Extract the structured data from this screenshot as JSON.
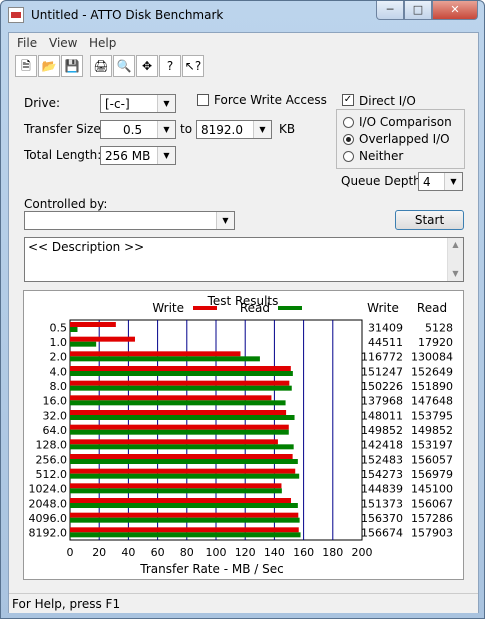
{
  "window": {
    "title": "Untitled - ATTO Disk Benchmark"
  },
  "menu": [
    "File",
    "View",
    "Help"
  ],
  "toolbar": [
    "new-file-icon",
    "open-folder-icon",
    "save-icon",
    "print-icon",
    "print-preview-icon",
    "move-icon",
    "help-icon",
    "context-help-icon"
  ],
  "form": {
    "drive_label": "Drive:",
    "drive_value": "[-c-]",
    "force_write_label": "Force Write Access",
    "direct_io_label": "Direct I/O",
    "direct_io_checked": true,
    "transfer_size_label": "Transfer Size:",
    "transfer_from": "0.5",
    "to_label": "to",
    "transfer_to": "8192.0",
    "kb_label": "KB",
    "total_length_label": "Total Length:",
    "total_length_value": "256 MB",
    "io_comparison_label": "I/O Comparison",
    "overlapped_label": "Overlapped I/O",
    "neither_label": "Neither",
    "queue_depth_label": "Queue Depth:",
    "queue_depth_value": "4",
    "controlled_by_label": "Controlled by:",
    "controlled_by_value": "",
    "start_label": "Start",
    "description": "<< Description >>"
  },
  "results": {
    "title": "Test Results",
    "legend_write": "Write",
    "legend_read": "Read",
    "col_write": "Write",
    "col_read": "Read"
  },
  "chart_data": {
    "type": "bar",
    "orientation": "horizontal",
    "categories": [
      "0.5",
      "1.0",
      "2.0",
      "4.0",
      "8.0",
      "16.0",
      "32.0",
      "64.0",
      "128.0",
      "256.0",
      "512.0",
      "1024.0",
      "2048.0",
      "4096.0",
      "8192.0"
    ],
    "series": [
      {
        "name": "Write",
        "color": "#e00000",
        "values": [
          31409,
          44511,
          116772,
          151247,
          150226,
          137968,
          148011,
          149852,
          142418,
          152483,
          154273,
          144839,
          151373,
          156370,
          156674
        ]
      },
      {
        "name": "Read",
        "color": "#008000",
        "values": [
          5128,
          17920,
          130084,
          152649,
          151890,
          147648,
          153795,
          149852,
          153197,
          156057,
          156979,
          145100,
          156067,
          157286,
          157903
        ]
      }
    ],
    "xlabel": "Transfer Rate - MB / Sec",
    "xticks": [
      "0",
      "20",
      "40",
      "60",
      "80",
      "100",
      "120",
      "140",
      "160",
      "180",
      "200"
    ],
    "xlim": [
      0,
      200
    ]
  },
  "status": "For Help, press F1"
}
